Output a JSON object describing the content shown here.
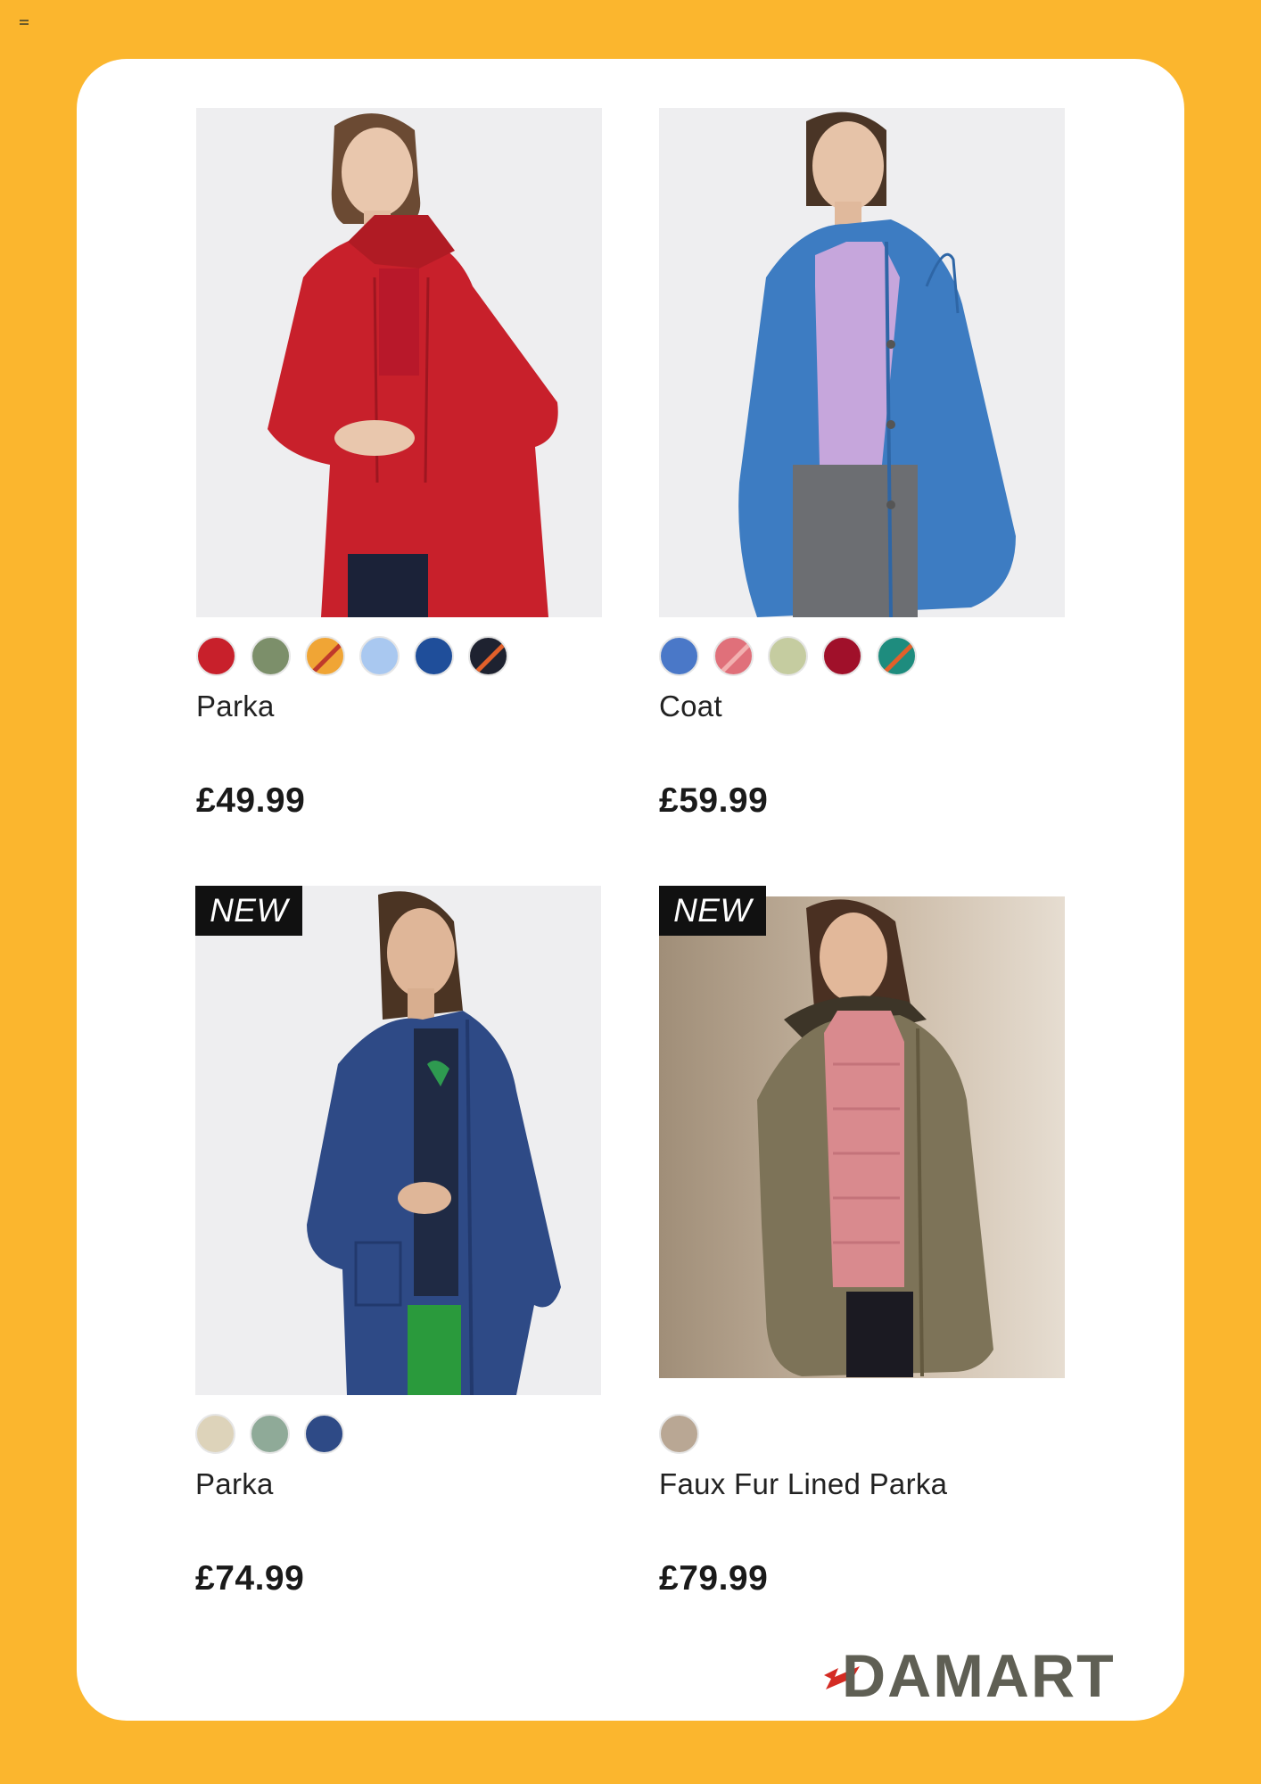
{
  "brand": {
    "logo_text": "DAMART",
    "accent": "#D42B23",
    "logo_color": "#5f5f54",
    "background": "#FBB62E"
  },
  "products": [
    {
      "name": "Parka",
      "price": "£49.99",
      "badge": "",
      "swatches": [
        {
          "color": "#C8202B",
          "stripe": ""
        },
        {
          "color": "#7C8F6A",
          "stripe": ""
        },
        {
          "color": "#F0A535",
          "stripe": "#C0392B"
        },
        {
          "color": "#A9C8F0",
          "stripe": ""
        },
        {
          "color": "#1F4E9A",
          "stripe": ""
        },
        {
          "color": "#1E2230",
          "stripe": "#E2602A"
        }
      ]
    },
    {
      "name": "Coat",
      "price": "£59.99",
      "badge": "",
      "swatches": [
        {
          "color": "#4A78C8",
          "stripe": ""
        },
        {
          "color": "#E0707A",
          "stripe": "#F2B0B0"
        },
        {
          "color": "#C5CCA0",
          "stripe": ""
        },
        {
          "color": "#A0102A",
          "stripe": ""
        },
        {
          "color": "#1E8C7E",
          "stripe": "#E2602A"
        }
      ]
    },
    {
      "name": "Parka",
      "price": "£74.99",
      "badge": "NEW",
      "swatches": [
        {
          "color": "#DDD3BA",
          "stripe": ""
        },
        {
          "color": "#8FAA98",
          "stripe": ""
        },
        {
          "color": "#2E4A86",
          "stripe": ""
        }
      ]
    },
    {
      "name": "Faux Fur Lined Parka",
      "price": "£79.99",
      "badge": "NEW",
      "swatches": [
        {
          "color": "#B9A794",
          "stripe": ""
        }
      ]
    }
  ]
}
